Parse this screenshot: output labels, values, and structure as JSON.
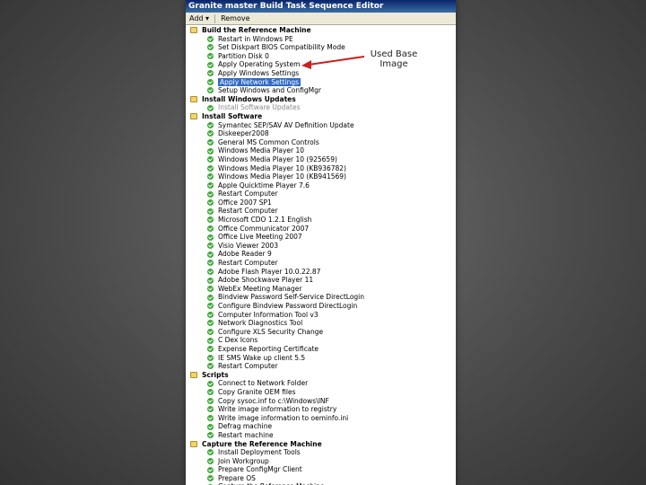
{
  "window": {
    "title": "Granite master Build Task Sequence Editor"
  },
  "toolbar": {
    "add_label": "Add",
    "remove_label": "Remove"
  },
  "callout": {
    "line1": "Used Base",
    "line2": "Image"
  },
  "colors": {
    "selection": "#316ac5",
    "arrow": "#cc1f1f",
    "titlebar": "#0a246a",
    "check": "#3fa83a"
  },
  "tree": [
    {
      "type": "group",
      "label": "Build the Reference Machine",
      "icon": "folder-icon"
    },
    {
      "type": "step",
      "label": "Restart in Windows PE",
      "icon": "check-icon"
    },
    {
      "type": "step",
      "label": "Set Diskpart BIOS Compatibility Mode",
      "icon": "check-icon"
    },
    {
      "type": "step",
      "label": "Partition Disk 0",
      "icon": "check-icon"
    },
    {
      "type": "step",
      "label": "Apply Operating System",
      "icon": "check-icon"
    },
    {
      "type": "step",
      "label": "Apply Windows Settings",
      "icon": "check-icon"
    },
    {
      "type": "step",
      "label": "Apply Network Settings",
      "icon": "check-icon",
      "selected": true
    },
    {
      "type": "step",
      "label": "Setup Windows and ConfigMgr",
      "icon": "check-icon"
    },
    {
      "type": "group",
      "label": "Install Windows Updates",
      "icon": "folder-icon"
    },
    {
      "type": "step",
      "label": "Install Software Updates",
      "icon": "check-icon",
      "disabled": true
    },
    {
      "type": "group",
      "label": "Install Software",
      "icon": "folder-icon"
    },
    {
      "type": "step",
      "label": "Symantec SEP/SAV AV Definition Update",
      "icon": "check-icon"
    },
    {
      "type": "step",
      "label": "Diskeeper2008",
      "icon": "check-icon"
    },
    {
      "type": "step",
      "label": "General MS Common Controls",
      "icon": "check-icon"
    },
    {
      "type": "step",
      "label": "Windows Media Player 10",
      "icon": "check-icon"
    },
    {
      "type": "step",
      "label": "Windows Media Player 10 (925659)",
      "icon": "check-icon"
    },
    {
      "type": "step",
      "label": "Windows Media Player 10 (KB936782)",
      "icon": "check-icon"
    },
    {
      "type": "step",
      "label": "Windows Media Player 10 (KB941569)",
      "icon": "check-icon"
    },
    {
      "type": "step",
      "label": "Apple Quicktime Player 7.6",
      "icon": "check-icon"
    },
    {
      "type": "step",
      "label": "Restart Computer",
      "icon": "check-icon"
    },
    {
      "type": "step",
      "label": "Office 2007 SP1",
      "icon": "check-icon"
    },
    {
      "type": "step",
      "label": "Restart Computer",
      "icon": "check-icon"
    },
    {
      "type": "step",
      "label": "Microsoft CDO 1.2.1 English",
      "icon": "check-icon"
    },
    {
      "type": "step",
      "label": "Office Communicator 2007",
      "icon": "check-icon"
    },
    {
      "type": "step",
      "label": "Office Live Meeting 2007",
      "icon": "check-icon"
    },
    {
      "type": "step",
      "label": "Visio Viewer 2003",
      "icon": "check-icon"
    },
    {
      "type": "step",
      "label": "Adobe Reader 9",
      "icon": "check-icon"
    },
    {
      "type": "step",
      "label": "Restart Computer",
      "icon": "check-icon"
    },
    {
      "type": "step",
      "label": "Adobe Flash Player 10.0.22.87",
      "icon": "check-icon"
    },
    {
      "type": "step",
      "label": "Adobe Shockwave Player 11",
      "icon": "check-icon"
    },
    {
      "type": "step",
      "label": "WebEx Meeting Manager",
      "icon": "check-icon"
    },
    {
      "type": "step",
      "label": "Bindview Password Self-Service DirectLogin",
      "icon": "check-icon"
    },
    {
      "type": "step",
      "label": "Configure Bindview Password DirectLogin",
      "icon": "check-icon"
    },
    {
      "type": "step",
      "label": "Computer Information Tool v3",
      "icon": "check-icon"
    },
    {
      "type": "step",
      "label": "Network Diagnostics Tool",
      "icon": "check-icon"
    },
    {
      "type": "step",
      "label": "Configure XLS Security Change",
      "icon": "check-icon"
    },
    {
      "type": "step",
      "label": "C Dex Icons",
      "icon": "check-icon"
    },
    {
      "type": "step",
      "label": "Expense Reporting Certificate",
      "icon": "check-icon"
    },
    {
      "type": "step",
      "label": "IE SMS Wake up client 5.5",
      "icon": "check-icon"
    },
    {
      "type": "step",
      "label": "Restart Computer",
      "icon": "check-icon"
    },
    {
      "type": "group",
      "label": "Scripts",
      "icon": "folder-icon"
    },
    {
      "type": "step",
      "label": "Connect to Network Folder",
      "icon": "check-icon"
    },
    {
      "type": "step",
      "label": "Copy Granite OEM files",
      "icon": "check-icon"
    },
    {
      "type": "step",
      "label": "Copy sysoc.inf to c:\\Windows\\INF",
      "icon": "check-icon"
    },
    {
      "type": "step",
      "label": "Write image information to registry",
      "icon": "check-icon"
    },
    {
      "type": "step",
      "label": "Write image information to oeminfo.ini",
      "icon": "check-icon"
    },
    {
      "type": "step",
      "label": "Defrag machine",
      "icon": "check-icon"
    },
    {
      "type": "step",
      "label": "Restart machine",
      "icon": "check-icon"
    },
    {
      "type": "group",
      "label": "Capture the Reference Machine",
      "icon": "folder-icon"
    },
    {
      "type": "step",
      "label": "Install Deployment Tools",
      "icon": "check-icon"
    },
    {
      "type": "step",
      "label": "Join Workgroup",
      "icon": "check-icon"
    },
    {
      "type": "step",
      "label": "Prepare ConfigMgr Client",
      "icon": "check-icon"
    },
    {
      "type": "step",
      "label": "Prepare OS",
      "icon": "check-icon"
    },
    {
      "type": "step",
      "label": "Capture the Reference Machine",
      "icon": "check-icon"
    }
  ]
}
